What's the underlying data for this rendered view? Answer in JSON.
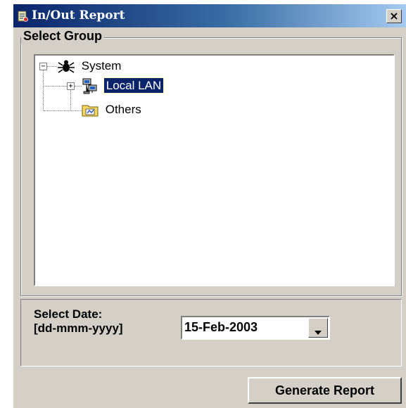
{
  "window": {
    "title": "In/Out Report",
    "close_symbol": "×",
    "title_icon": "report-app-icon",
    "titlebar_color": "#0a246a"
  },
  "select_group": {
    "label": "Select Group",
    "tree": {
      "root": {
        "label": "System",
        "icon": "spider-icon",
        "expander": "−",
        "expanded": true
      },
      "children": [
        {
          "label": "Local LAN",
          "icon": "network-computers-icon",
          "expander": "+",
          "selected": true
        },
        {
          "label": "Others",
          "icon": "folder-icon"
        }
      ]
    },
    "selection_color": "#0a246a"
  },
  "select_date": {
    "label_line1": "Select Date:",
    "label_line2": "[dd-mmm-yyyy]",
    "value": "15-Feb-2003",
    "dropdown_icon": "chevron-down-icon"
  },
  "actions": {
    "generate_report_label": "Generate Report"
  }
}
